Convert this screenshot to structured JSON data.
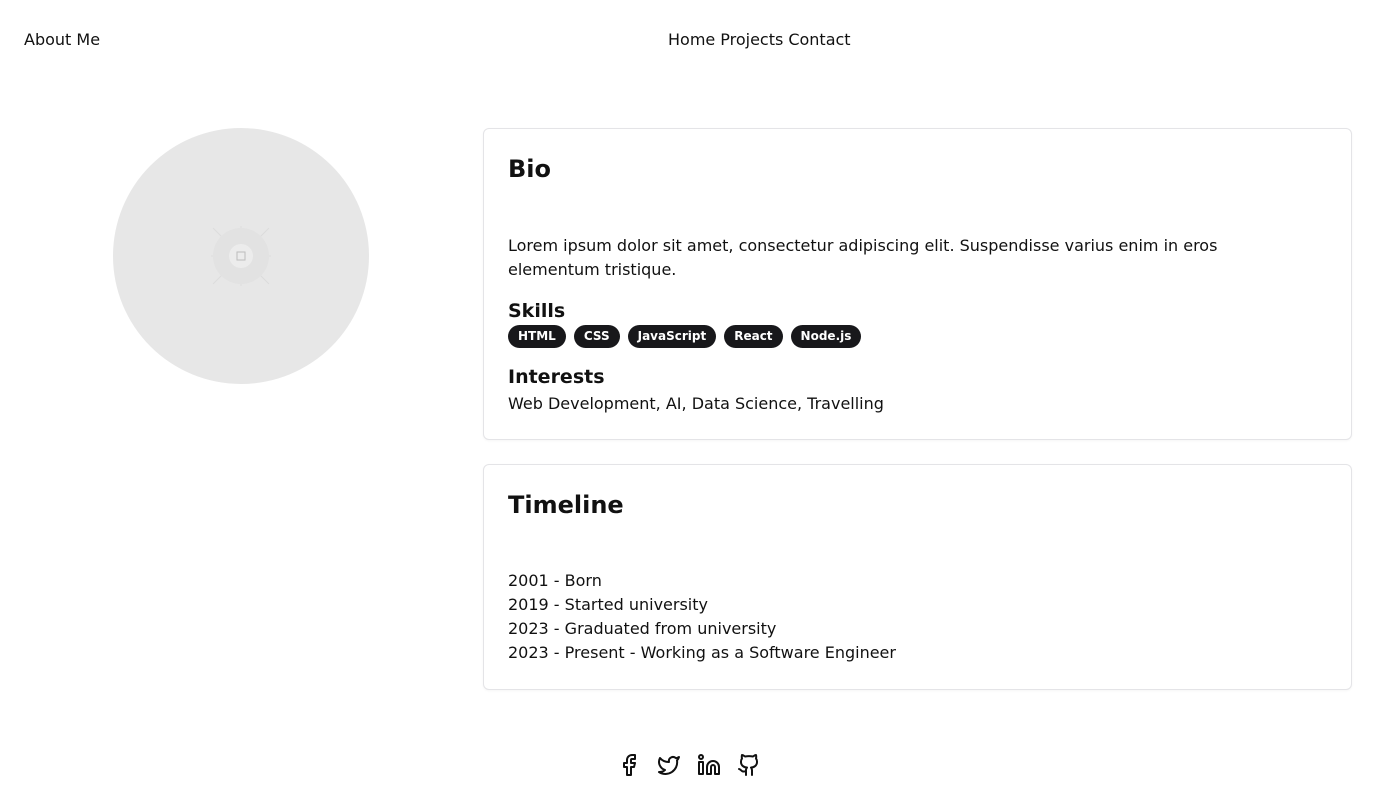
{
  "header": {
    "brand": "About Me",
    "nav": [
      "Home",
      "Projects",
      "Contact"
    ]
  },
  "bio": {
    "title": "Bio",
    "text": "Lorem ipsum dolor sit amet, consectetur adipiscing elit. Suspendisse varius enim in eros elementum tristique.",
    "skills_title": "Skills",
    "skills": [
      "HTML",
      "CSS",
      "JavaScript",
      "React",
      "Node.js"
    ],
    "interests_title": "Interests",
    "interests": "Web Development, AI, Data Science, Travelling"
  },
  "timeline": {
    "title": "Timeline",
    "items": [
      "2001 - Born",
      "2019 - Started university",
      "2023 - Graduated from university",
      "2023 - Present - Working as a Software Engineer"
    ]
  },
  "social": [
    "facebook-icon",
    "twitter-icon",
    "linkedin-icon",
    "github-icon"
  ],
  "colors": {
    "badge_bg": "#18181b",
    "avatar_bg": "#e7e7e7",
    "card_border": "#e4e4e7"
  }
}
